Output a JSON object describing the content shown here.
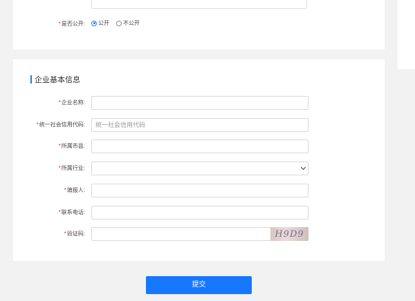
{
  "visibility": {
    "label": "是否公开:",
    "options": [
      {
        "label": "公开",
        "checked": true
      },
      {
        "label": "不公开",
        "checked": false
      }
    ]
  },
  "section": {
    "title": "企业基本信息",
    "accent_color": "#1677ff"
  },
  "fields": [
    {
      "label": "企业名称:",
      "value": "",
      "placeholder": ""
    },
    {
      "label": "统一社会信用代码:",
      "value": "",
      "placeholder": "统一社会信用代码"
    },
    {
      "label": "所属市县:",
      "value": "",
      "placeholder": ""
    },
    {
      "label": "所属行业:",
      "value": "",
      "placeholder": ""
    },
    {
      "label": "填报人:",
      "value": "",
      "placeholder": ""
    },
    {
      "label": "联系电话:",
      "value": "",
      "placeholder": ""
    },
    {
      "label": "验证码:",
      "value": "",
      "placeholder": ""
    }
  ],
  "captcha": {
    "text": "H9D9"
  },
  "submit": {
    "label": "提交"
  }
}
